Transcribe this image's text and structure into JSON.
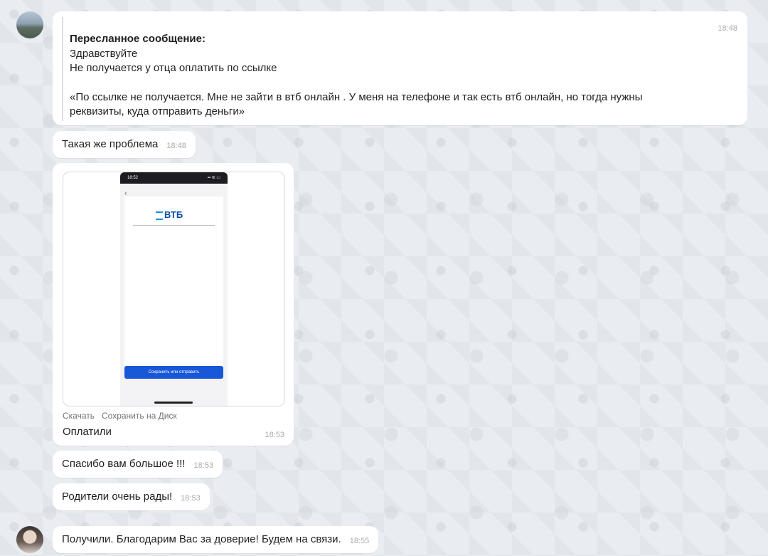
{
  "forwarded": {
    "header": "Пересланное сообщение:",
    "line1": "Здравствуйте",
    "line2": "Не получается у отца оплатить по ссылке",
    "quote": "«По ссылке не получается. Мне не зайти в втб онлайн . У меня на телефоне и так есть втб онлайн, но тогда нужны реквизиты, куда отправить деньги»",
    "time": "18:48"
  },
  "messages": [
    {
      "text": "Такая же проблема",
      "time": "18:48"
    },
    {
      "text": "Спасибо вам большое !!!",
      "time": "18:53"
    },
    {
      "text": "Родители очень рады!",
      "time": "18:53"
    },
    {
      "text": "Получили. Благодарим Вас за доверие! Будем на связи.",
      "time": "18:55"
    }
  ],
  "image_message": {
    "phone_time": "18:52",
    "phone_status_icons": "▪▪ ≋ ▭",
    "back": "‹",
    "bank_logo": "ВТБ",
    "button_label": "Сохранить или отправить",
    "download_label": "Скачать",
    "save_disk_label": "Сохранить на Диск",
    "caption": "Оплатили",
    "time": "18:53"
  }
}
